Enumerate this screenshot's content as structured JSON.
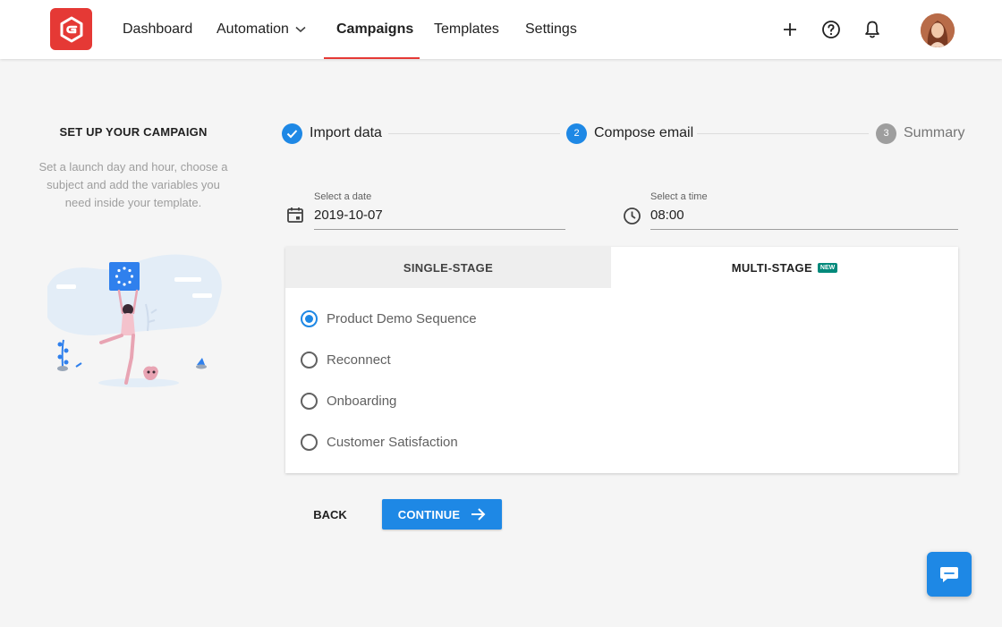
{
  "nav": {
    "items": [
      {
        "label": "Dashboard"
      },
      {
        "label": "Automation"
      },
      {
        "label": "Campaigns"
      },
      {
        "label": "Templates"
      },
      {
        "label": "Settings"
      }
    ],
    "active": "Campaigns",
    "icons": [
      "plus-icon",
      "help-icon",
      "bell-icon"
    ]
  },
  "left": {
    "title": "SET UP YOUR CAMPAIGN",
    "desc_lines": [
      "Set a launch day and hour, choose a",
      "subject and add the variables you",
      "need inside your template."
    ]
  },
  "stepper": {
    "steps": [
      {
        "label": "Import data",
        "state": "done"
      },
      {
        "number": "2",
        "label": "Compose email",
        "state": "active"
      },
      {
        "number": "3",
        "label": "Summary",
        "state": "pending"
      }
    ]
  },
  "date": {
    "label": "Select a date",
    "value": "2019-10-07"
  },
  "time": {
    "label": "Select a time",
    "value": "08:00"
  },
  "tabs": {
    "single": "SINGLE-STAGE",
    "multi": "MULTI-STAGE",
    "new_badge": "NEW",
    "selected": "multi"
  },
  "options": [
    {
      "label": "Product Demo Sequence",
      "selected": true
    },
    {
      "label": "Reconnect",
      "selected": false
    },
    {
      "label": "Onboarding",
      "selected": false
    },
    {
      "label": "Customer Satisfaction",
      "selected": false
    }
  ],
  "buttons": {
    "back": "BACK",
    "continue": "CONTINUE"
  },
  "colors": {
    "accent": "#1e88e5",
    "brand": "#e53935",
    "badge": "#00897b"
  }
}
